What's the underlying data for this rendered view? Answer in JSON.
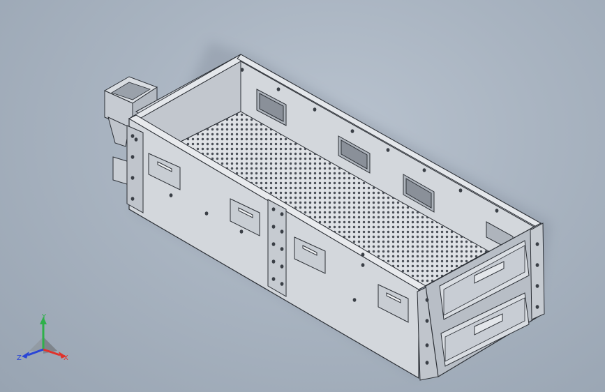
{
  "viewport": {
    "background_top": "#b9c3cf",
    "background_bottom": "#98a4b2",
    "model": "perforated-tray-box-assembly"
  },
  "colors": {
    "face_light": "#d6dae0",
    "face_mid": "#c3c8cf",
    "face_dark": "#a9afb7",
    "edge": "#2b2f35",
    "perforation": "#4a4f57",
    "shadow": "#7b8594"
  },
  "triad": {
    "x_label": "X",
    "y_label": "Y",
    "z_label": "Z",
    "x_color": "#e0322b",
    "y_color": "#2fb04a",
    "z_color": "#2a45d6"
  }
}
